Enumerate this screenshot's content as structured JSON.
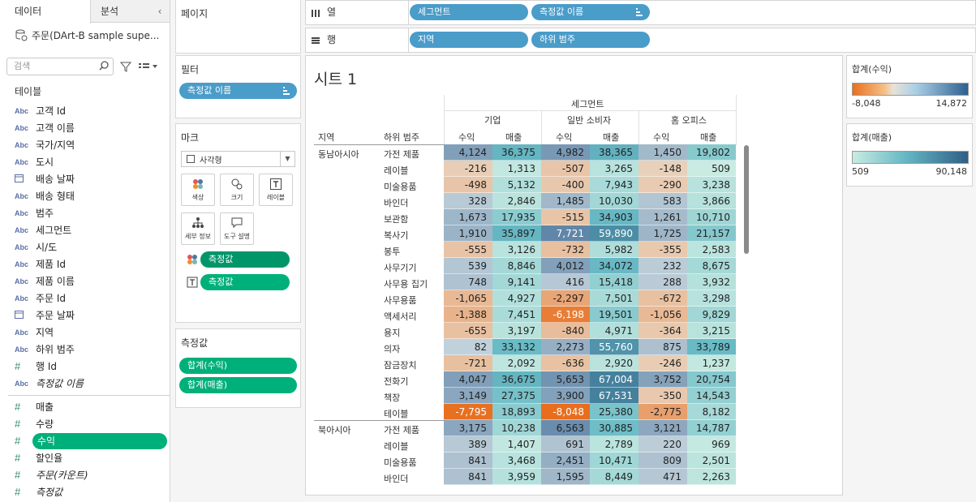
{
  "tabs": {
    "data": "데이터",
    "analysis": "분석"
  },
  "datasource": "주문(DArt-B sample supe...",
  "search_placeholder": "검색",
  "tables_header": "테이블",
  "fields": [
    {
      "name": "고객 Id",
      "icon": "Abc"
    },
    {
      "name": "고객 이름",
      "icon": "Abc"
    },
    {
      "name": "국가/지역",
      "icon": "Abc"
    },
    {
      "name": "도시",
      "icon": "Abc"
    },
    {
      "name": "배송 날짜",
      "icon": "calendar"
    },
    {
      "name": "배송 형태",
      "icon": "Abc"
    },
    {
      "name": "범주",
      "icon": "Abc"
    },
    {
      "name": "세그먼트",
      "icon": "Abc"
    },
    {
      "name": "시/도",
      "icon": "Abc"
    },
    {
      "name": "제품 Id",
      "icon": "Abc"
    },
    {
      "name": "제품 이름",
      "icon": "Abc"
    },
    {
      "name": "주문 Id",
      "icon": "Abc"
    },
    {
      "name": "주문 날짜",
      "icon": "calendar"
    },
    {
      "name": "지역",
      "icon": "Abc"
    },
    {
      "name": "하위 범주",
      "icon": "Abc"
    },
    {
      "name": "행 Id",
      "icon": "#"
    },
    {
      "name": "측정값 이름",
      "icon": "Abc",
      "italic": true
    }
  ],
  "measures": [
    {
      "name": "매출",
      "icon": "#"
    },
    {
      "name": "수량",
      "icon": "#"
    },
    {
      "name": "수익",
      "icon": "#",
      "selected": true
    },
    {
      "name": "할인율",
      "icon": "#"
    },
    {
      "name": "주문(카운트)",
      "icon": "#",
      "italic": true
    },
    {
      "name": "측정값",
      "icon": "#",
      "italic": true
    }
  ],
  "pages_label": "페이지",
  "filters": {
    "title": "필터",
    "pill": "측정값 이름"
  },
  "marks": {
    "title": "마크",
    "type": "사각형",
    "buttons": {
      "color": "색상",
      "size": "크기",
      "label": "레이블",
      "detail": "세부 정보",
      "tooltip": "도구 설명"
    },
    "enc1": "측정값",
    "enc2": "측정값"
  },
  "measure_values": {
    "title": "측정값",
    "items": [
      "합계(수익)",
      "합계(매출)"
    ]
  },
  "columns_shelf": {
    "label": "열",
    "pills": [
      "세그먼트",
      "측정값 이름"
    ]
  },
  "rows_shelf": {
    "label": "행",
    "pills": [
      "지역",
      "하위 범주"
    ]
  },
  "sheet": {
    "title": "시트 1",
    "segment_header": "세그먼트",
    "segments": [
      "기업",
      "일반 소비자",
      "홈 오피스"
    ],
    "measure_headers": [
      "수익",
      "매출"
    ],
    "row_headers": [
      "지역",
      "하위 범주"
    ]
  },
  "legends": [
    {
      "title": "합계(수익)",
      "min": "-8,048",
      "max": "14,872"
    },
    {
      "title": "합계(매출)",
      "min": "509",
      "max": "90,148"
    }
  ],
  "table": {
    "regions": [
      {
        "name": "동남아시아",
        "rows": [
          {
            "sub": "가전 제품",
            "v": [
              4124,
              36375,
              4982,
              38365,
              1450,
              19802
            ]
          },
          {
            "sub": "레이블",
            "v": [
              -216,
              1313,
              -507,
              3265,
              -148,
              509
            ]
          },
          {
            "sub": "미술용품",
            "v": [
              -498,
              5132,
              -400,
              7943,
              -290,
              3238
            ]
          },
          {
            "sub": "바인더",
            "v": [
              328,
              2846,
              1485,
              10030,
              583,
              3866
            ]
          },
          {
            "sub": "보관함",
            "v": [
              1673,
              17935,
              -515,
              34903,
              1261,
              10710
            ]
          },
          {
            "sub": "복사기",
            "v": [
              1910,
              35897,
              7721,
              59890,
              1725,
              21157
            ]
          },
          {
            "sub": "봉투",
            "v": [
              -555,
              3126,
              -732,
              5982,
              -355,
              2583
            ]
          },
          {
            "sub": "사무기기",
            "v": [
              539,
              8846,
              4012,
              34072,
              232,
              8675
            ]
          },
          {
            "sub": "사무용 집기",
            "v": [
              748,
              9141,
              416,
              15418,
              288,
              3932
            ]
          },
          {
            "sub": "사무용품",
            "v": [
              -1065,
              4927,
              -2297,
              7501,
              -672,
              3298
            ]
          },
          {
            "sub": "액세서리",
            "v": [
              -1388,
              7451,
              -6198,
              19501,
              -1056,
              9829
            ]
          },
          {
            "sub": "용지",
            "v": [
              -655,
              3197,
              -840,
              4971,
              -364,
              3215
            ]
          },
          {
            "sub": "의자",
            "v": [
              82,
              33132,
              2273,
              55760,
              875,
              33789
            ]
          },
          {
            "sub": "잠금장치",
            "v": [
              -721,
              2092,
              -636,
              2920,
              -246,
              1237
            ]
          },
          {
            "sub": "전화기",
            "v": [
              4047,
              36675,
              5653,
              67004,
              3752,
              20754
            ]
          },
          {
            "sub": "책장",
            "v": [
              3149,
              27375,
              3900,
              67531,
              -350,
              14543
            ]
          },
          {
            "sub": "테이블",
            "v": [
              -7795,
              18893,
              -8048,
              25380,
              -2775,
              8182
            ]
          }
        ]
      },
      {
        "name": "북아시아",
        "rows": [
          {
            "sub": "가전 제품",
            "v": [
              3175,
              10238,
              6563,
              30885,
              3121,
              14787
            ]
          },
          {
            "sub": "레이블",
            "v": [
              389,
              1407,
              691,
              2789,
              220,
              969
            ]
          },
          {
            "sub": "미술용품",
            "v": [
              841,
              3468,
              2451,
              10471,
              809,
              2501
            ]
          },
          {
            "sub": "바인더",
            "v": [
              841,
              3959,
              1595,
              8449,
              471,
              2263
            ]
          }
        ]
      }
    ]
  },
  "colors": {
    "accent": "#00b07a",
    "pill": "#4a9cc9",
    "profit_neg": "#e8711f",
    "profit_pos": "#2e5f8f",
    "sales_low": "#c9ebe2",
    "sales_high": "#2f5f86"
  }
}
